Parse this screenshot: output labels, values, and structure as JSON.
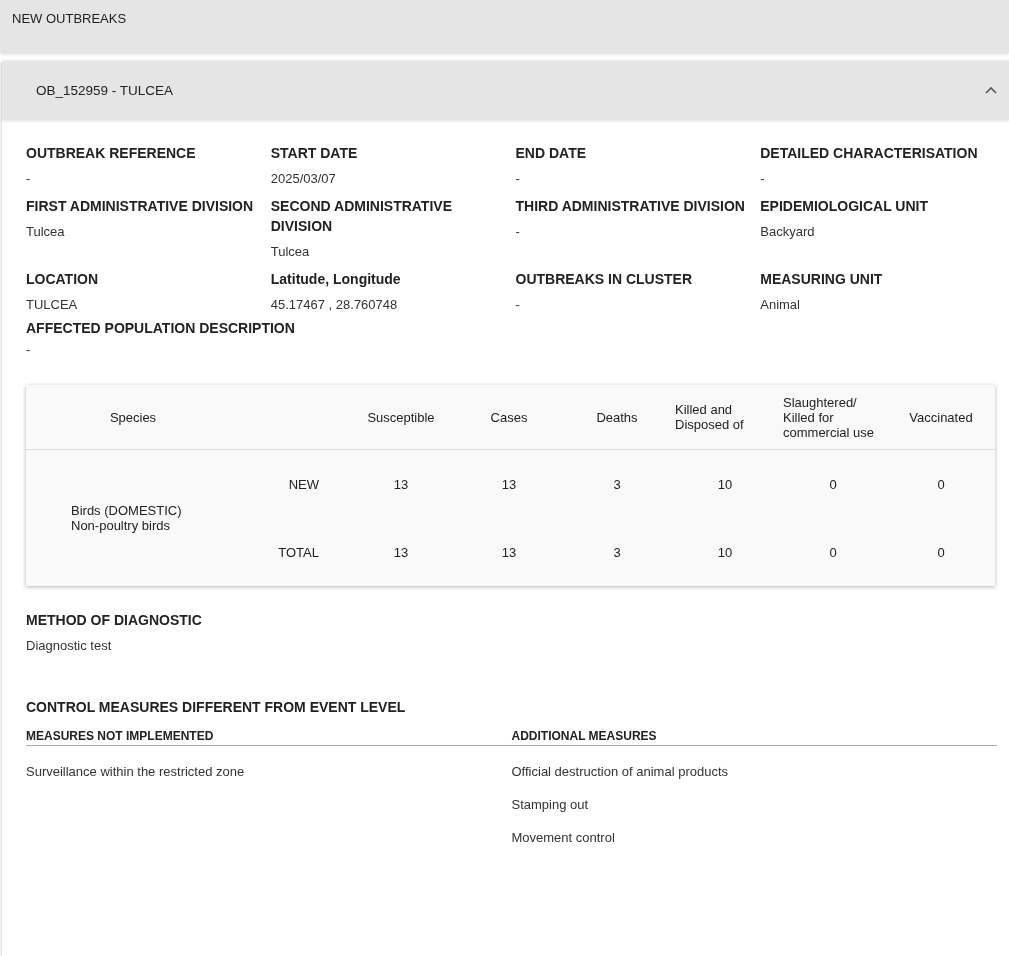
{
  "section_title": "NEW OUTBREAKS",
  "outbreak": {
    "title": "OB_152959 - TULCEA",
    "expanded": true,
    "fields": [
      {
        "label": "OUTBREAK REFERENCE",
        "value": "-"
      },
      {
        "label": "START DATE",
        "value": "2025/03/07"
      },
      {
        "label": "END DATE",
        "value": "-"
      },
      {
        "label": "DETAILED CHARACTERISATION",
        "value": "-"
      },
      {
        "label": "FIRST ADMINISTRATIVE DIVISION",
        "value": "Tulcea"
      },
      {
        "label": "SECOND ADMINISTRATIVE DIVISION",
        "value": "Tulcea"
      },
      {
        "label": "THIRD ADMINISTRATIVE DIVISION",
        "value": "-"
      },
      {
        "label": "EPIDEMIOLOGICAL UNIT",
        "value": "Backyard"
      },
      {
        "label": "LOCATION",
        "value": "TULCEA"
      },
      {
        "label": "Latitude, Longitude",
        "value": "45.17467 , 28.760748"
      },
      {
        "label": "OUTBREAKS IN CLUSTER",
        "value": "-"
      },
      {
        "label": "MEASURING UNIT",
        "value": "Animal"
      }
    ],
    "affected_population": {
      "label": "AFFECTED POPULATION DESCRIPTION",
      "value": "-"
    },
    "table": {
      "species_header": "Species",
      "columns": [
        "Susceptible",
        "Cases",
        "Deaths",
        "Killed and Disposed of",
        "Slaughtered/ Killed for commercial use",
        "Vaccinated"
      ],
      "groups": [
        {
          "species": [
            "Birds (DOMESTIC)",
            "Non-poultry birds"
          ],
          "rows": [
            {
              "label": "NEW",
              "values": [
                "13",
                "13",
                "3",
                "10",
                "0",
                "0"
              ]
            },
            {
              "label": "TOTAL",
              "values": [
                "13",
                "13",
                "3",
                "10",
                "0",
                "0"
              ]
            }
          ]
        }
      ]
    },
    "diagnostic": {
      "label": "METHOD OF DIAGNOSTIC",
      "value": "Diagnostic test"
    },
    "control": {
      "title": "CONTROL MEASURES DIFFERENT FROM EVENT LEVEL",
      "columns": [
        {
          "heading": "MEASURES NOT IMPLEMENTED",
          "items": [
            "Surveillance within the restricted zone"
          ]
        },
        {
          "heading": "ADDITIONAL MEASURES",
          "items": [
            "Official destruction of animal products",
            "Stamping out",
            "Movement control"
          ]
        }
      ]
    }
  }
}
